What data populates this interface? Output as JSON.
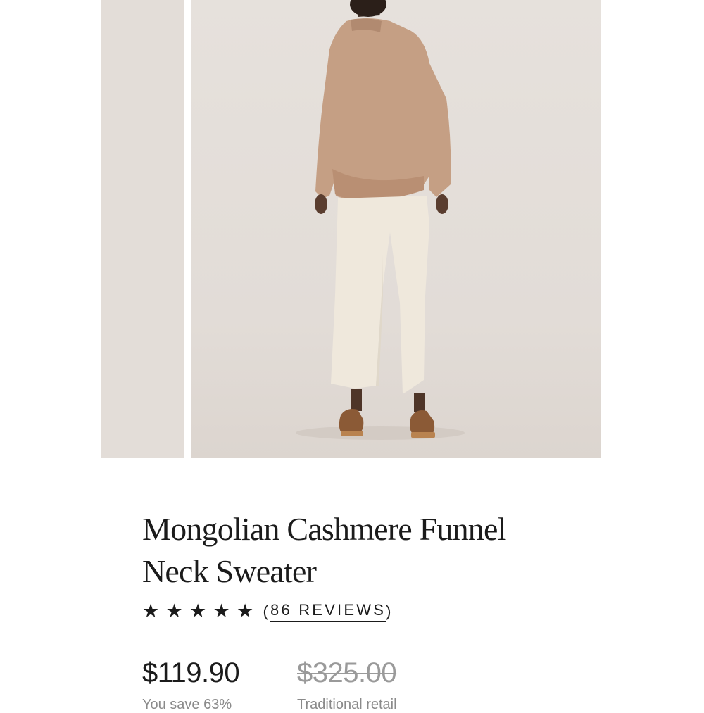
{
  "product": {
    "title": "Mongolian Cashmere Funnel Neck Sweater",
    "rating": {
      "stars": 5,
      "max_stars": 5,
      "reviews_label": "86 REVIEWS"
    },
    "price": "$119.90",
    "original_price": "$325.00",
    "savings_note": "You save 63%",
    "traditional_retail_note": "Traditional retail"
  },
  "gallery": {
    "images": [
      {
        "alt": "product-image-partial"
      },
      {
        "alt": "product-image-back-view"
      }
    ]
  },
  "colors": {
    "sweater": "#c49e83",
    "pants": "#efe8db",
    "background": "#e4dfda",
    "text": "#1b1b1b",
    "strike_price": "#9a9a9a"
  }
}
